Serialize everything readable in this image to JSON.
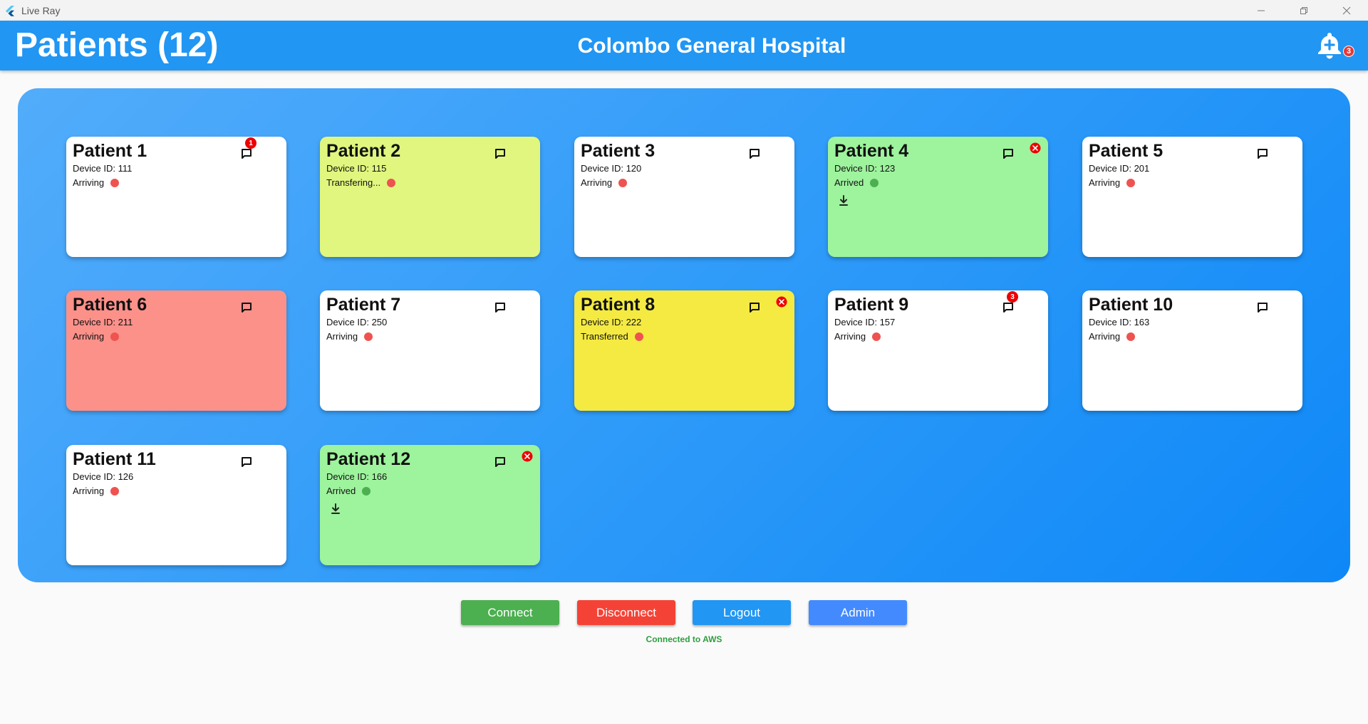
{
  "window": {
    "title": "Live Ray"
  },
  "header": {
    "title": "Patients (12)",
    "hospital": "Colombo General Hospital",
    "notification_count": "3"
  },
  "colors": {
    "appbar": "#2196f3",
    "white_card": "#ffffff",
    "transfering_card": "#e0f67e",
    "arrived_card": "#9ef39d",
    "alert_card": "#fc918a",
    "transferred_card": "#f4ea42",
    "dot_red": "#ef5350",
    "dot_green": "#4caf50"
  },
  "patients": [
    {
      "name": "Patient 1",
      "device": "Device ID: 111",
      "status": "Arriving",
      "card_color": "#ffffff",
      "dot_color": "#ef5350",
      "msg_badge": "1",
      "closable": false,
      "downloadable": false
    },
    {
      "name": "Patient 2",
      "device": "Device ID: 115",
      "status": "Transfering...",
      "card_color": "#e0f67e",
      "dot_color": "#ef5350",
      "msg_badge": "",
      "closable": false,
      "downloadable": false
    },
    {
      "name": "Patient 3",
      "device": "Device ID: 120",
      "status": "Arriving",
      "card_color": "#ffffff",
      "dot_color": "#ef5350",
      "msg_badge": "",
      "closable": false,
      "downloadable": false
    },
    {
      "name": "Patient 4",
      "device": "Device ID: 123",
      "status": "Arrived",
      "card_color": "#9ef39d",
      "dot_color": "#4caf50",
      "msg_badge": "",
      "closable": true,
      "downloadable": true
    },
    {
      "name": "Patient 5",
      "device": "Device ID: 201",
      "status": "Arriving",
      "card_color": "#ffffff",
      "dot_color": "#ef5350",
      "msg_badge": "",
      "closable": false,
      "downloadable": false
    },
    {
      "name": "Patient 6",
      "device": "Device ID: 211",
      "status": "Arriving",
      "card_color": "#fc918a",
      "dot_color": "#ef5350",
      "msg_badge": "",
      "closable": false,
      "downloadable": false
    },
    {
      "name": "Patient 7",
      "device": "Device ID: 250",
      "status": "Arriving",
      "card_color": "#ffffff",
      "dot_color": "#ef5350",
      "msg_badge": "",
      "closable": false,
      "downloadable": false
    },
    {
      "name": "Patient 8",
      "device": "Device ID: 222",
      "status": "Transferred",
      "card_color": "#f4ea42",
      "dot_color": "#ef5350",
      "msg_badge": "",
      "closable": true,
      "downloadable": false
    },
    {
      "name": "Patient 9",
      "device": "Device ID: 157",
      "status": "Arriving",
      "card_color": "#ffffff",
      "dot_color": "#ef5350",
      "msg_badge": "3",
      "closable": false,
      "downloadable": false
    },
    {
      "name": "Patient 10",
      "device": "Device ID: 163",
      "status": "Arriving",
      "card_color": "#ffffff",
      "dot_color": "#ef5350",
      "msg_badge": "",
      "closable": false,
      "downloadable": false
    },
    {
      "name": "Patient 11",
      "device": "Device ID: 126",
      "status": "Arriving",
      "card_color": "#ffffff",
      "dot_color": "#ef5350",
      "msg_badge": "",
      "closable": false,
      "downloadable": false
    },
    {
      "name": "Patient 12",
      "device": "Device ID: 166",
      "status": "Arrived",
      "card_color": "#9ef39d",
      "dot_color": "#4caf50",
      "msg_badge": "",
      "closable": true,
      "downloadable": true
    }
  ],
  "actions": {
    "connect": {
      "label": "Connect",
      "color": "#4caf50"
    },
    "disconnect": {
      "label": "Disconnect",
      "color": "#f44336"
    },
    "logout": {
      "label": "Logout",
      "color": "#2196f3"
    },
    "admin": {
      "label": "Admin",
      "color": "#448aff"
    }
  },
  "connection_status": "Connected to AWS"
}
